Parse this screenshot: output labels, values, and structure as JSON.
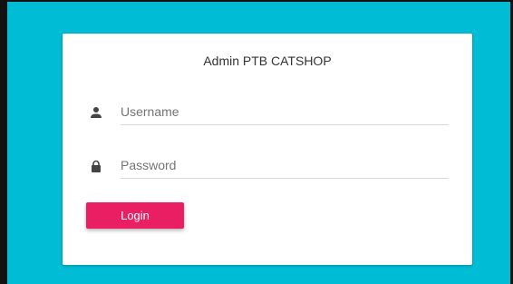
{
  "login_card": {
    "title": "Admin PTB CATSHOP",
    "username": {
      "icon": "person-icon",
      "placeholder": "Username",
      "value": ""
    },
    "password": {
      "icon": "lock-icon",
      "placeholder": "Password",
      "value": ""
    },
    "login_label": "Login"
  },
  "colors": {
    "background": "#00bcd4",
    "card": "#ffffff",
    "button": "#e91e63"
  }
}
